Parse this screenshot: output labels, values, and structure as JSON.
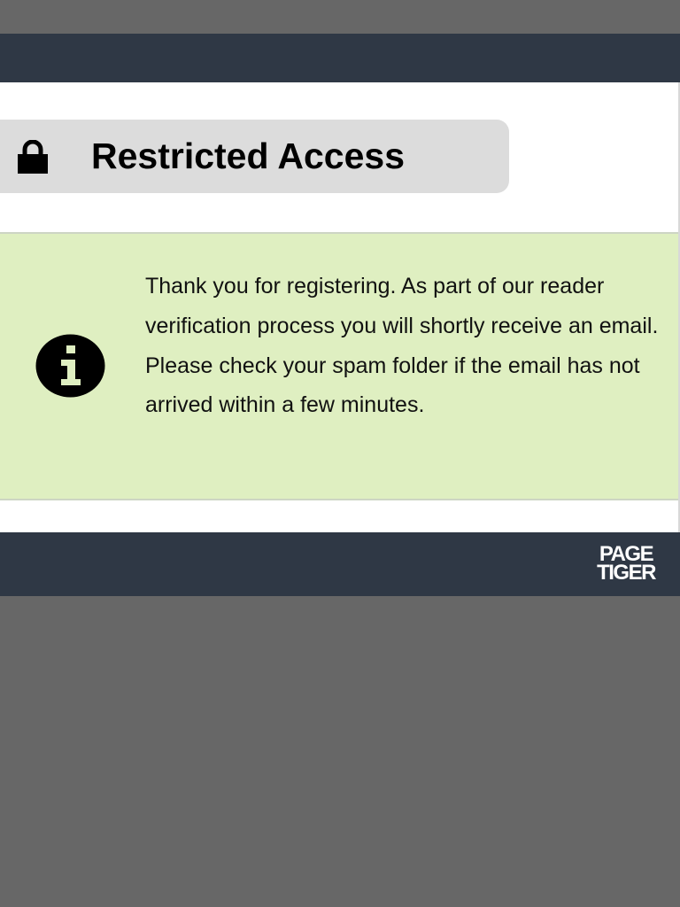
{
  "header": {
    "title": "Restricted Access",
    "lock_icon": "lock-icon"
  },
  "notice": {
    "info_icon": "info-icon",
    "background_color": "#dfefc1",
    "paragraphs": [
      "Thank you for registering. As part of our reader verification process you will shortly receive an email.",
      "Please check your spam folder if the email has not arrived within a few minutes."
    ]
  },
  "footer": {
    "logo_line1": "PAGE",
    "logo_line2": "TIGER"
  },
  "colors": {
    "bar": "#2f3845",
    "backdrop": "#676767",
    "title_pill": "#dcdcdc"
  }
}
